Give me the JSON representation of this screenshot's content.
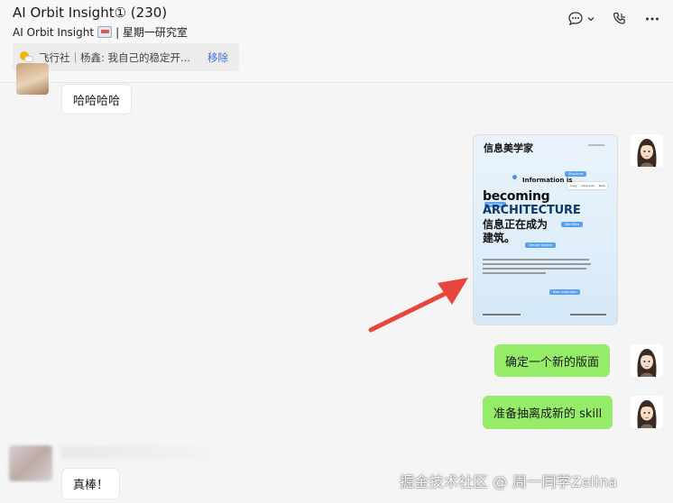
{
  "header": {
    "title": "AI Orbit Insight① (230)",
    "subtitle_prefix": "AI Orbit Insight",
    "subtitle_suffix": "| 星期一研究室",
    "pinned_message": "飞行社｜杨鑫: 我自己的稳定开...",
    "pinned_remove_label": "移除",
    "icons": [
      "chat-bubble-icon",
      "chevron-down-icon",
      "phone-icon",
      "more-icon"
    ]
  },
  "messages": [
    {
      "side": "left",
      "text": "哈哈哈哈"
    },
    {
      "side": "right",
      "type": "image",
      "image": {
        "title": "信息美学家",
        "info_line": "Information is",
        "becoming": "becoming",
        "architecture": "ARCHITECTURE",
        "cn_line1": "信息正在成为",
        "cn_line2": "建筑。",
        "tags": [
          "Structure",
          "Interface",
          "Workflow",
          "Design System",
          "New Institution"
        ],
        "menu": [
          "Copy",
          "Select All",
          "Note"
        ]
      }
    },
    {
      "side": "right",
      "text": "确定一个新的版面"
    },
    {
      "side": "right",
      "text": "准备抽离成新的 skill"
    },
    {
      "side": "left",
      "text": "真棒！"
    }
  ],
  "watermark": "掘金技术社区 @ 周一同学Zelina",
  "colors": {
    "green_bubble": "#95ec69",
    "arrow": "#e8453c",
    "link": "#3a6fd8"
  }
}
